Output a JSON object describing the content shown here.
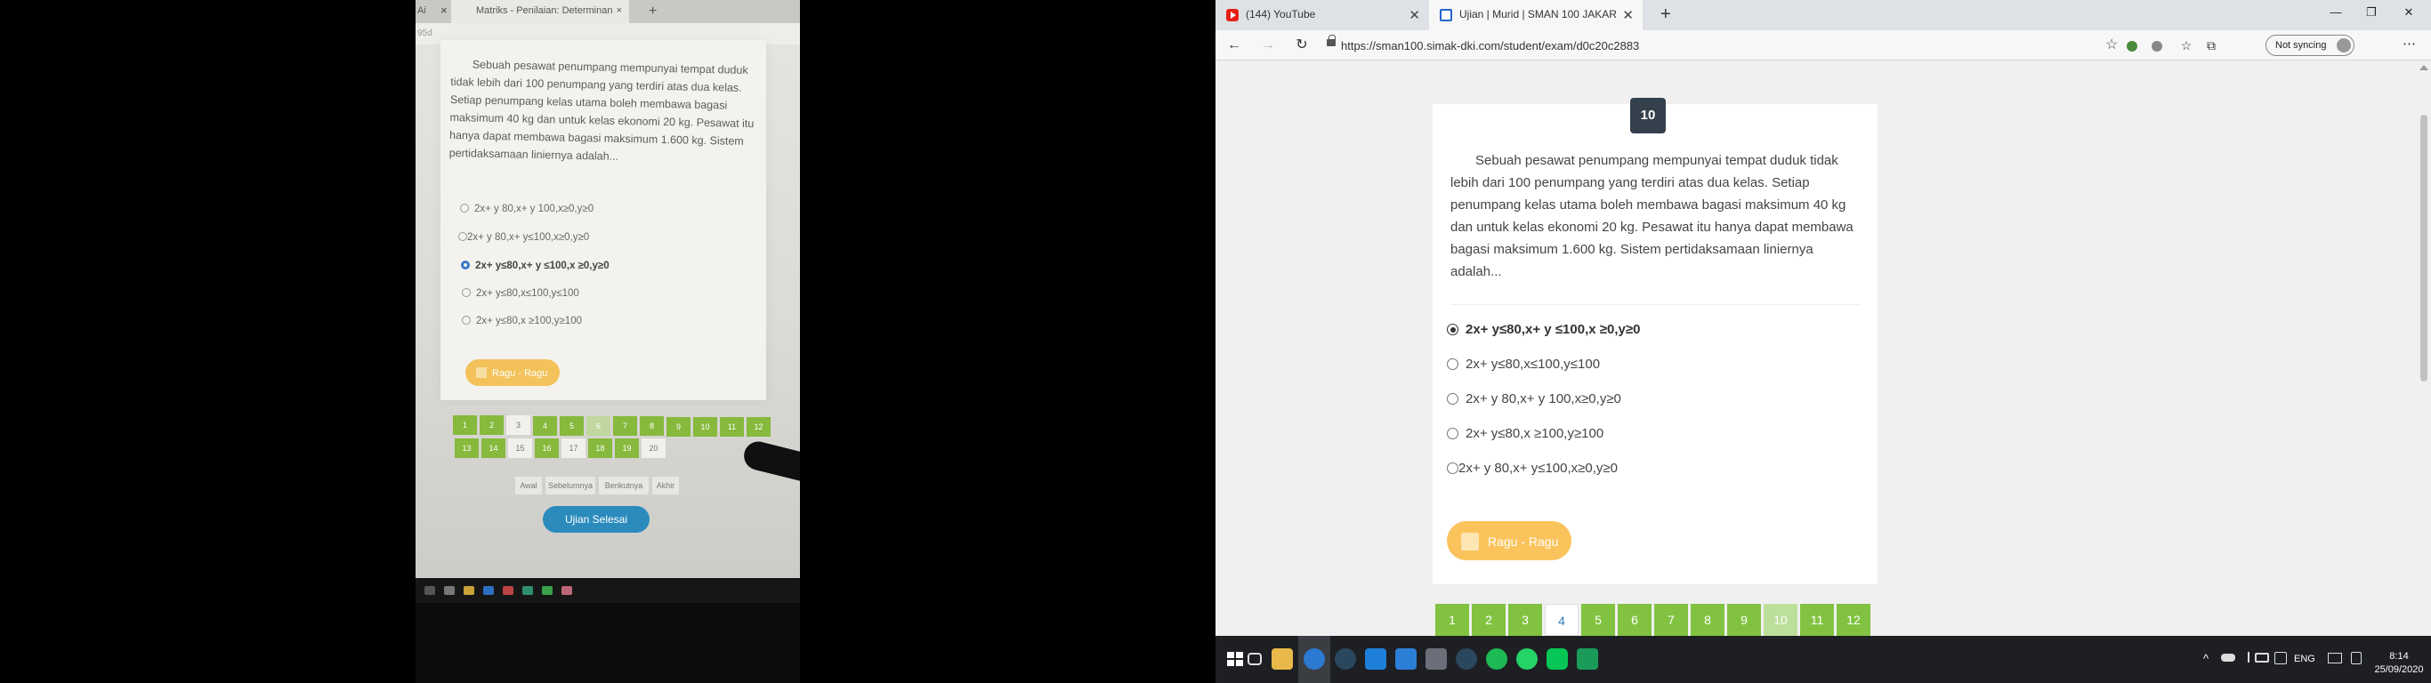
{
  "photo": {
    "tab_title": "Matriks - Penilaian: Determinan",
    "tab_left_fragment": "Ai",
    "tab_close": "×",
    "new_tab": "+",
    "url_fragment": "95d",
    "question": "Sebuah pesawat penumpang mempunyai tempat duduk tidak lebih dari 100 penumpang yang terdiri atas dua kelas. Setiap penumpang kelas utama boleh membawa bagasi maksimum 40 kg dan untuk kelas ekonomi 20 kg. Pesawat itu hanya dapat membawa bagasi maksimum 1.600 kg. Sistem pertidaksamaan liniernya adalah...",
    "options": [
      "2x+ y 80,x+ y 100,x≥0,y≥0",
      "2x+ y 80,x+ y≤100,x≥0,y≥0",
      "2x+ y≤80,x+ y ≤100,x ≥0,y≥0",
      "2x+ y≤80,x≤100,y≤100",
      "2x+ y≤80,x ≥100,y≥100"
    ],
    "ragu_label": "Ragu - Ragu",
    "numbers_row1": [
      "1",
      "2",
      "3",
      "4",
      "5",
      "6",
      "7",
      "8",
      "9",
      "10",
      "11",
      "12"
    ],
    "numbers_row2": [
      "13",
      "14",
      "15",
      "16",
      "17",
      "18",
      "19",
      "20"
    ],
    "nav": [
      "Awal",
      "Sebelumnya",
      "Berikutnya",
      "Akhir"
    ],
    "finish_label": "Ujian Selesai"
  },
  "browser": {
    "tabs": [
      {
        "title": "(144) YouTube",
        "icon": "youtube-icon"
      },
      {
        "title": "Ujian | Murid | SMAN 100 JAKAR",
        "icon": "bookmark-icon"
      }
    ],
    "tab_close": "✕",
    "new_tab": "+",
    "window_controls": {
      "minimize": "—",
      "restore": "❐",
      "close": "✕"
    },
    "nav": {
      "back": "←",
      "forward": "→",
      "refresh": "↻"
    },
    "url": "https://sman100.simak-dki.com/student/exam/d0c20c2883",
    "star": "☆",
    "sync_label": "Not syncing",
    "menu": "⋯",
    "toolbar_glyphs": {
      "favorites": "☆",
      "collections": "⧉"
    }
  },
  "exam": {
    "question_number": "10",
    "question": "Sebuah pesawat penumpang mempunyai tempat duduk tidak lebih dari 100 penumpang yang terdiri atas dua kelas.  Setiap penumpang kelas utama boleh membawa bagasi maksimum 40 kg dan untuk kelas ekonomi 20 kg. Pesawat itu hanya dapat membawa bagasi maksimum 1.600 kg.  Sistem pertidaksamaan liniernya adalah...",
    "options": [
      {
        "text": "2x+ y≤80,x+ y ≤100,x ≥0,y≥0",
        "selected": true
      },
      {
        "text": "2x+ y≤80,x≤100,y≤100",
        "selected": false
      },
      {
        "text": "2x+ y 80,x+ y 100,x≥0,y≥0",
        "selected": false
      },
      {
        "text": "2x+ y≤80,x ≥100,y≥100",
        "selected": false
      },
      {
        "text": "2x+ y 80,x+ y≤100,x≥0,y≥0",
        "selected": false
      }
    ],
    "ragu_label": "Ragu - Ragu",
    "pages": [
      "1",
      "2",
      "3",
      "4",
      "5",
      "6",
      "7",
      "8",
      "9",
      "10",
      "11",
      "12"
    ],
    "current_page": "10",
    "unanswered_page": "4"
  },
  "taskbar": {
    "tray_language": "ENG",
    "time": "8:14",
    "date": "25/09/2020",
    "tray_caret": "^"
  },
  "colors": {
    "accent_green": "#81c341",
    "question_badge": "#34404b",
    "ragu_yellow": "#fbc35b",
    "finish_blue": "#2b8bbd",
    "taskbar": "#1d1f23"
  }
}
